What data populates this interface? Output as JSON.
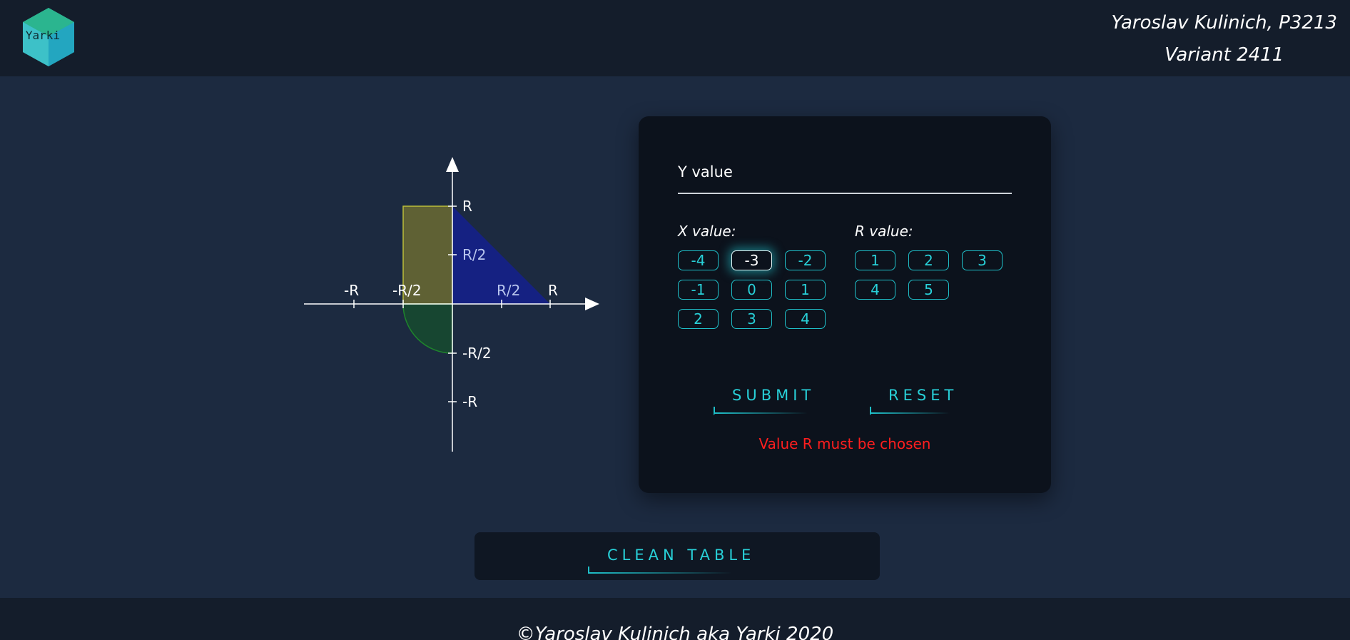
{
  "header": {
    "logo_text": "Yarki",
    "author": "Yaroslav Kulinich, P3213",
    "variant": "Variant 2411"
  },
  "graph": {
    "labels": {
      "r": "R",
      "r_half": "R/2",
      "minus_r": "-R",
      "minus_r_half": "-R/2"
    },
    "colors": {
      "rectangle": "#6b6b32",
      "triangle": "#15208a",
      "quarter_circle": "#174a30"
    }
  },
  "form": {
    "y_label": "Y value",
    "x_label": "X value:",
    "r_label": "R value:",
    "x_options": [
      "-4",
      "-3",
      "-2",
      "-1",
      "0",
      "1",
      "2",
      "3",
      "4"
    ],
    "x_selected": "-3",
    "r_options": [
      "1",
      "2",
      "3",
      "4",
      "5"
    ],
    "submit_label": "SUBMIT",
    "reset_label": "RESET",
    "error": "Value R must be chosen"
  },
  "clean_table_label": "CLEAN TABLE",
  "footer": "©Yaroslav Kulinich aka Yarki 2020",
  "accent_color": "#28d0d8",
  "error_color": "#ff1e1e"
}
